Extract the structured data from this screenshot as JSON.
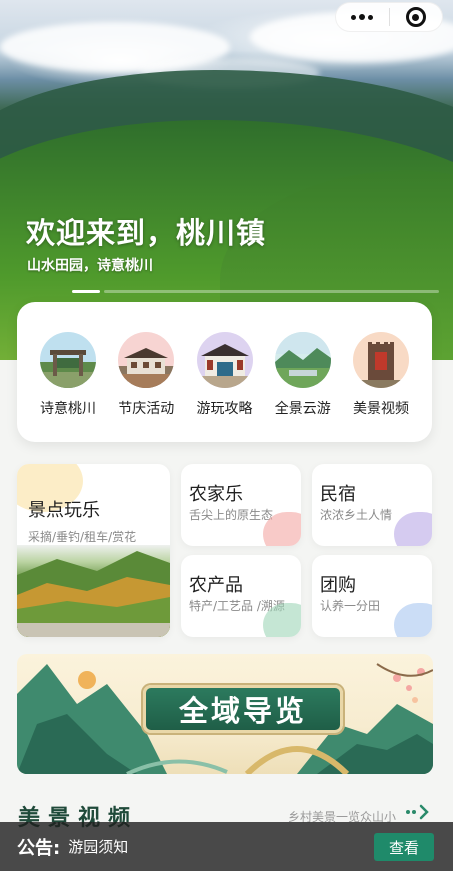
{
  "hero": {
    "title": "欢迎来到，桃川镇",
    "subtitle": "山水田园，诗意桃川"
  },
  "categories": [
    {
      "label": "诗意桃川",
      "icon": "gate-photo-icon",
      "color": "#bfe0ef"
    },
    {
      "label": "节庆活动",
      "icon": "village-photo-icon",
      "color": "#f7d4d2"
    },
    {
      "label": "游玩攻略",
      "icon": "pavilion-photo-icon",
      "color": "#ddd3f0"
    },
    {
      "label": "全景云游",
      "icon": "panorama-photo-icon",
      "color": "#d5ecec"
    },
    {
      "label": "美景视频",
      "icon": "tower-photo-icon",
      "color": "#f8dac5"
    }
  ],
  "tiles": {
    "scenic": {
      "title": "景点玩乐",
      "subtitle": "采摘/垂钓/租车/赏花"
    },
    "farmhouse": {
      "title": "农家乐",
      "subtitle": "舌尖上的原生态",
      "color": "#f4a7a3"
    },
    "homestay": {
      "title": "民宿",
      "subtitle": "浓浓乡土人情",
      "color": "#b9a8e6"
    },
    "products": {
      "title": "农产品",
      "subtitle": "特产/工艺品 /溯源",
      "color": "#9fd6b8"
    },
    "groupbuy": {
      "title": "团购",
      "subtitle": "认养一分田",
      "color": "#a9c6f0"
    }
  },
  "banner": {
    "label": "全域导览"
  },
  "section": {
    "title": "美景视频",
    "more": "乡村美景一览众山小"
  },
  "notice": {
    "label": "公告:",
    "text": "游园须知",
    "button": "查看"
  },
  "colors": {
    "accent": "#1f8a6a",
    "banner_plaque": "#24684f"
  }
}
